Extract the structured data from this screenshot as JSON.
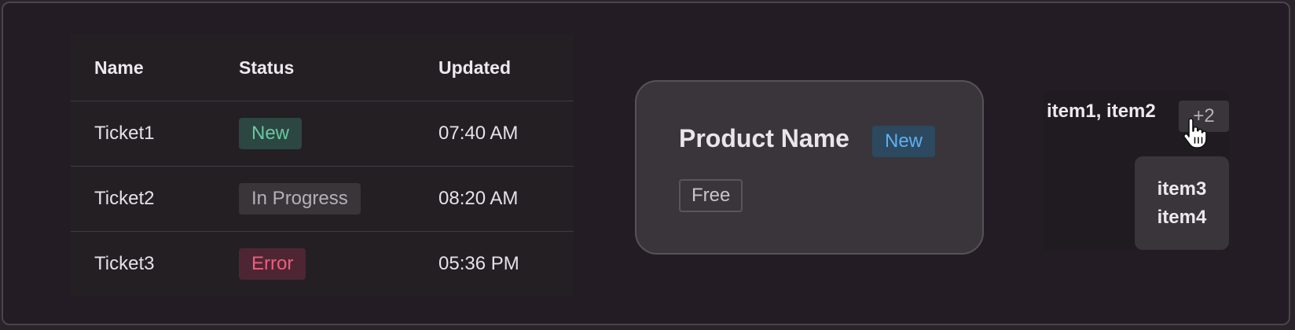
{
  "table": {
    "headers": {
      "name": "Name",
      "status": "Status",
      "updated": "Updated"
    },
    "rows": [
      {
        "name": "Ticket1",
        "status": "New",
        "status_kind": "new",
        "updated": "07:40 AM"
      },
      {
        "name": "Ticket2",
        "status": "In Progress",
        "status_kind": "progress",
        "updated": "08:20 AM"
      },
      {
        "name": "Ticket3",
        "status": "Error",
        "status_kind": "error",
        "updated": "05:36 PM"
      }
    ]
  },
  "card": {
    "title": "Product Name",
    "badge": "New",
    "tag": "Free"
  },
  "overflow": {
    "visible_items": "item1, item2",
    "more_label": "+2",
    "hidden_items": [
      "item3",
      "item4"
    ]
  },
  "colors": {
    "background": "#241c24",
    "badge_new_green": "#67c8a2",
    "badge_error_red": "#ee5d7e",
    "badge_new_blue": "#5fb0f2"
  },
  "icons": {
    "cursor": "hand-pointer-icon"
  }
}
